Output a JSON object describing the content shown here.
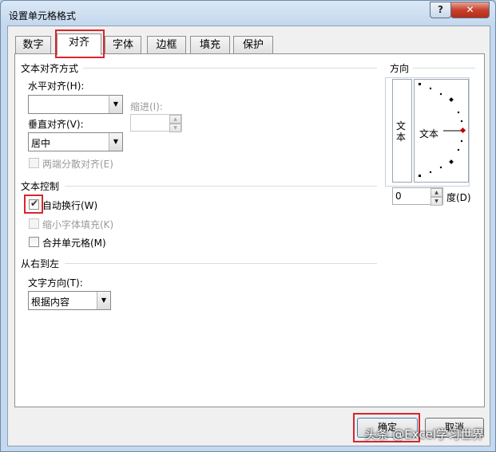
{
  "window": {
    "title": "设置单元格格式",
    "help_label": "?",
    "close_label": "✕"
  },
  "tabs": [
    {
      "label": "数字"
    },
    {
      "label": "对齐",
      "active": true
    },
    {
      "label": "字体"
    },
    {
      "label": "边框"
    },
    {
      "label": "填充"
    },
    {
      "label": "保护"
    }
  ],
  "alignment": {
    "group_title": "文本对齐方式",
    "horizontal_label": "水平对齐(H):",
    "horizontal_value": "",
    "indent_label": "缩进(I):",
    "indent_value": "",
    "vertical_label": "垂直对齐(V):",
    "vertical_value": "居中",
    "justify_distributed_label": "两端分散对齐(E)"
  },
  "text_control": {
    "group_title": "文本控制",
    "wrap_text_label": "自动换行(W)",
    "wrap_text_checked": true,
    "shrink_to_fit_label": "缩小字体填充(K)",
    "shrink_to_fit_checked": false,
    "merge_cells_label": "合并单元格(M)",
    "merge_cells_checked": false
  },
  "right_to_left": {
    "group_title": "从右到左",
    "direction_label": "文字方向(T):",
    "direction_value": "根据内容"
  },
  "orientation": {
    "group_title": "方向",
    "vertical_text": "文本",
    "dial_text": "文本",
    "degrees_value": "0",
    "degrees_label": "度(D)"
  },
  "buttons": {
    "ok_label": "确定",
    "cancel_label": "取消"
  },
  "watermark": "头条 @Excel学习世界",
  "colors": {
    "highlight": "#d8262c",
    "dial_needle": "#c00000"
  }
}
